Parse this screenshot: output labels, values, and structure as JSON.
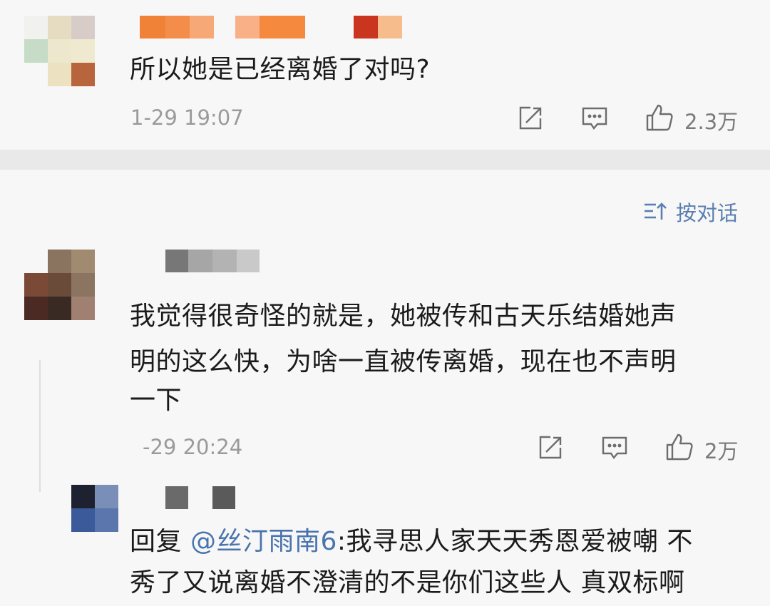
{
  "comment1": {
    "text": "所以她是已经离婚了对吗?",
    "time": "1-29 19:07",
    "like_count": "2.3万",
    "icons": [
      "share-icon",
      "comment-icon",
      "like-icon"
    ]
  },
  "sort": {
    "icon": "sort-icon",
    "label": "按对话"
  },
  "comment2": {
    "text_line1": "我觉得很奇怪的就是，她被传和古天乐结婚她声",
    "text_line2": "明的这么快，为啥一直被传离婚，现在也不声明",
    "text_line3": "一下",
    "time": "-29 20:24",
    "like_count": "2万",
    "icons": [
      "share-icon",
      "comment-icon",
      "like-icon"
    ]
  },
  "reply1": {
    "prefix": "回复 ",
    "mention": "@丝汀雨南6",
    "text_line1": ":我寻思人家天天秀恩爱被嘲 不",
    "text_line2": "秀了又说离婚不澄清的不是你们这些人 真双标啊"
  }
}
